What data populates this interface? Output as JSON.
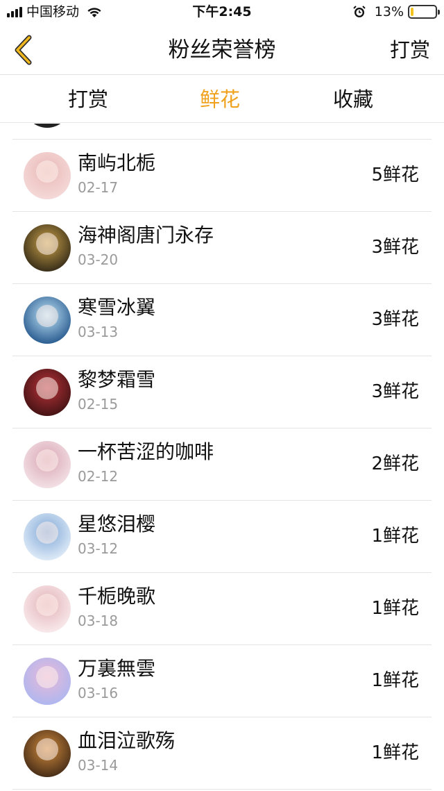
{
  "status_bar": {
    "carrier": "中国移动",
    "time": "下午2:45",
    "battery_percent": "13%",
    "battery_level": 0.13,
    "battery_color": "#f4c21d"
  },
  "nav": {
    "back_icon": "chevron-left-icon",
    "title": "粉丝荣誉榜",
    "action_label": "打赏",
    "accent_color": "#f0a21e"
  },
  "tabs": [
    {
      "label": "打赏",
      "active": false
    },
    {
      "label": "鲜花",
      "active": true
    },
    {
      "label": "收藏",
      "active": false
    }
  ],
  "fans": [
    {
      "name": "南屿北栀",
      "date": "02-17",
      "amount": "5鲜花",
      "avatar_colors": [
        "#f6dcdc",
        "#e8b9b6"
      ]
    },
    {
      "name": "海神阁唐门永存",
      "date": "03-20",
      "amount": "3鲜花",
      "avatar_colors": [
        "#2a2214",
        "#caa24a"
      ]
    },
    {
      "name": "寒雪冰翼",
      "date": "03-13",
      "amount": "3鲜花",
      "avatar_colors": [
        "#1c4f86",
        "#bfe3f7"
      ]
    },
    {
      "name": "黎梦霜雪",
      "date": "02-15",
      "amount": "3鲜花",
      "avatar_colors": [
        "#3a1010",
        "#b8333a"
      ]
    },
    {
      "name": "一杯苦涩的咖啡",
      "date": "02-12",
      "amount": "2鲜花",
      "avatar_colors": [
        "#f5e6ea",
        "#d9a5b4"
      ]
    },
    {
      "name": "星悠泪樱",
      "date": "03-12",
      "amount": "1鲜花",
      "avatar_colors": [
        "#e8f2fb",
        "#7fa6d6"
      ]
    },
    {
      "name": "千栀晚歌",
      "date": "03-18",
      "amount": "1鲜花",
      "avatar_colors": [
        "#fbeff0",
        "#e2b2b8"
      ]
    },
    {
      "name": "万裏無雲",
      "date": "03-16",
      "amount": "1鲜花",
      "avatar_colors": [
        "#a9b7f2",
        "#e9b8d8"
      ]
    },
    {
      "name": "血泪泣歌殇",
      "date": "03-14",
      "amount": "1鲜花",
      "avatar_colors": [
        "#3a2414",
        "#d08a3c"
      ]
    }
  ]
}
